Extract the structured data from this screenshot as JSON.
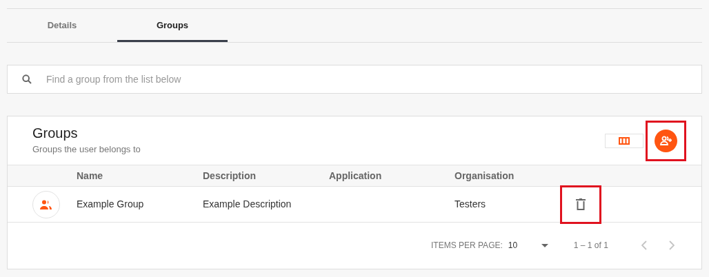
{
  "tabs": [
    {
      "label": "Details",
      "selected": false
    },
    {
      "label": "Groups",
      "selected": true
    }
  ],
  "search": {
    "placeholder": "Find a group from the list below"
  },
  "card": {
    "title": "Groups",
    "subtitle": "Groups the user belongs to",
    "add_button": {
      "highlighted": true
    }
  },
  "table": {
    "columns": [
      "Name",
      "Description",
      "Application",
      "Organisation"
    ],
    "rows": [
      {
        "cells": [
          "Example Group",
          "Example Description",
          "",
          "Testers"
        ],
        "delete_highlighted": true
      }
    ]
  },
  "pagination": {
    "label": "ITEMS PER PAGE:",
    "page_size": "10",
    "range": "1 – 1 of 1",
    "prev_disabled": true,
    "next_disabled": true
  }
}
